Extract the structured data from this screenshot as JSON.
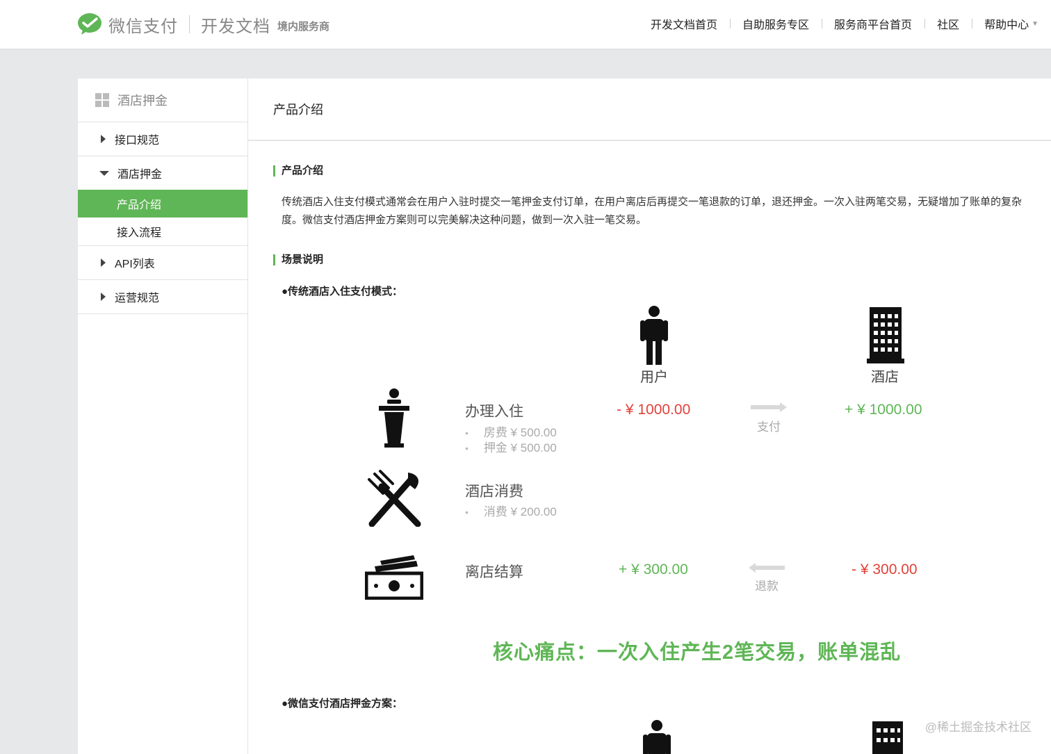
{
  "header": {
    "brand": "微信支付",
    "docs": "开发文档",
    "sub": "境内服务商",
    "nav": [
      "开发文档首页",
      "自助服务专区",
      "服务商平台首页",
      "社区",
      "帮助中心"
    ]
  },
  "sidebar": {
    "title": "酒店押金",
    "items": [
      {
        "label": "接口规范"
      },
      {
        "label": "酒店押金",
        "children": [
          "产品介绍",
          "接入流程"
        ]
      },
      {
        "label": "API列表"
      },
      {
        "label": "运营规范"
      }
    ]
  },
  "main": {
    "page_title": "产品介绍",
    "section1_title": "产品介绍",
    "intro": "传统酒店入住支付模式通常会在用户入驻时提交一笔押金支付订单，在用户离店后再提交一笔退款的订单，退还押金。一次入驻两笔交易，无疑增加了账单的复杂度。微信支付酒店押金方案则可以完美解决这种问题，做到一次入驻一笔交易。",
    "section2_title": "场景说明",
    "bullet1": "●传统酒店入住支付模式：",
    "bullet2": "●微信支付酒店押金方案：",
    "diagram": {
      "user_label": "用户",
      "hotel_label": "酒店",
      "rows": {
        "checkin": {
          "title": "办理入住",
          "sub1": "房费 ¥ 500.00",
          "sub2": "押金 ¥ 500.00",
          "user_amt": "- ¥ 1000.00",
          "arrow": "支付",
          "hotel_amt": "+ ¥ 1000.00"
        },
        "consume": {
          "title": "酒店消费",
          "sub1": "消费 ¥ 200.00"
        },
        "checkout": {
          "title": "离店结算",
          "user_amt": "+ ¥ 300.00",
          "arrow": "退款",
          "hotel_amt": "- ¥ 300.00"
        }
      },
      "pain_point": "核心痛点：一次入住产生2笔交易，账单混乱"
    }
  },
  "watermark": "@稀土掘金技术社区",
  "colors": {
    "accent": "#5fb656",
    "red": "#e3413a"
  }
}
